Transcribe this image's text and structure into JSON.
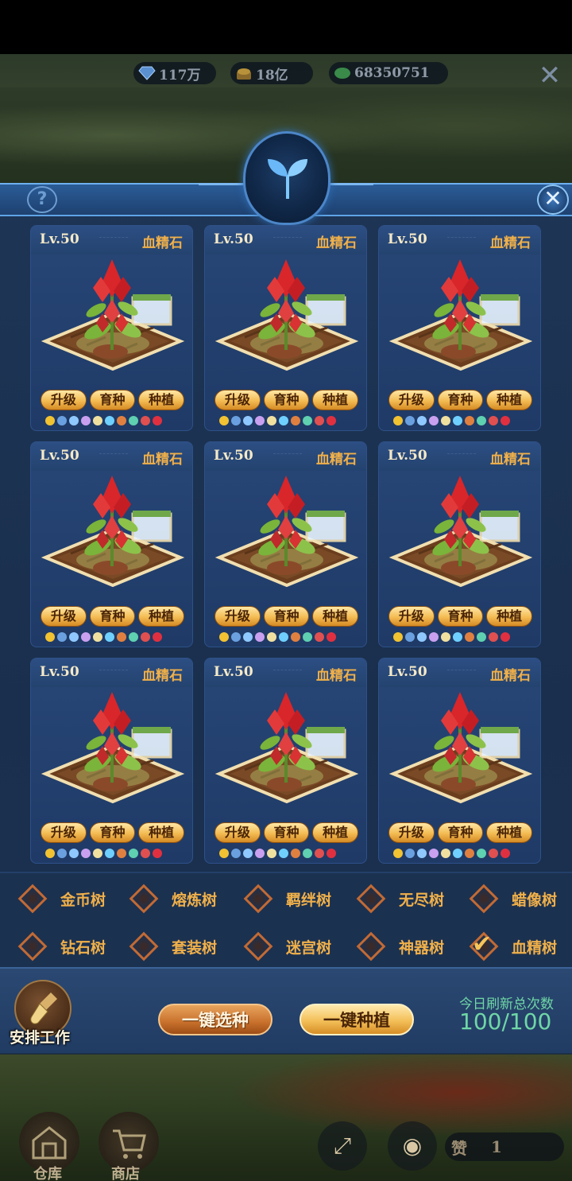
{
  "resources": {
    "diamond": "117万",
    "gold": "18亿",
    "exp": "68350751"
  },
  "panel": {
    "help_label": "?",
    "close_label": "✕"
  },
  "cards": [
    {
      "level": "Lv.50",
      "name": "血精石",
      "buttons": [
        "升级",
        "育种",
        "种植"
      ]
    },
    {
      "level": "Lv.50",
      "name": "血精石",
      "buttons": [
        "升级",
        "育种",
        "种植"
      ]
    },
    {
      "level": "Lv.50",
      "name": "血精石",
      "buttons": [
        "升级",
        "育种",
        "种植"
      ]
    },
    {
      "level": "Lv.50",
      "name": "血精石",
      "buttons": [
        "升级",
        "育种",
        "种植"
      ]
    },
    {
      "level": "Lv.50",
      "name": "血精石",
      "buttons": [
        "升级",
        "育种",
        "种植"
      ]
    },
    {
      "level": "Lv.50",
      "name": "血精石",
      "buttons": [
        "升级",
        "育种",
        "种植"
      ]
    },
    {
      "level": "Lv.50",
      "name": "血精石",
      "buttons": [
        "升级",
        "育种",
        "种植"
      ]
    },
    {
      "level": "Lv.50",
      "name": "血精石",
      "buttons": [
        "升级",
        "育种",
        "种植"
      ]
    },
    {
      "level": "Lv.50",
      "name": "血精石",
      "buttons": [
        "升级",
        "育种",
        "种植"
      ]
    }
  ],
  "attribute_icons": [
    "gold-icon",
    "swirl-icon",
    "wing-icon",
    "ring-icon",
    "candle-icon",
    "gem-icon",
    "armor-icon",
    "orb-icon",
    "feather-icon",
    "crystal-icon"
  ],
  "attribute_colors": [
    "#f1c232",
    "#6aa0e0",
    "#8fc8ff",
    "#c9a0f0",
    "#f0e0a0",
    "#6fd0ff",
    "#e08040",
    "#5fd0b0",
    "#e05050",
    "#e03040"
  ],
  "trees": [
    {
      "label": "金币树",
      "checked": false
    },
    {
      "label": "熔炼树",
      "checked": false
    },
    {
      "label": "羁绊树",
      "checked": false
    },
    {
      "label": "无尽树",
      "checked": false
    },
    {
      "label": "蜡像树",
      "checked": false
    },
    {
      "label": "钻石树",
      "checked": false
    },
    {
      "label": "套装树",
      "checked": false
    },
    {
      "label": "迷宫树",
      "checked": false
    },
    {
      "label": "神器树",
      "checked": false
    },
    {
      "label": "血精树",
      "checked": true
    }
  ],
  "footer": {
    "work_label": "安排工作",
    "select_all": "一键选种",
    "plant_all": "一键种植",
    "refresh_label": "今日刷新总次数",
    "refresh_value": "100/100"
  },
  "dock": {
    "warehouse": "仓库",
    "shop": "商店",
    "like_label": "赞",
    "like_count": "1"
  }
}
